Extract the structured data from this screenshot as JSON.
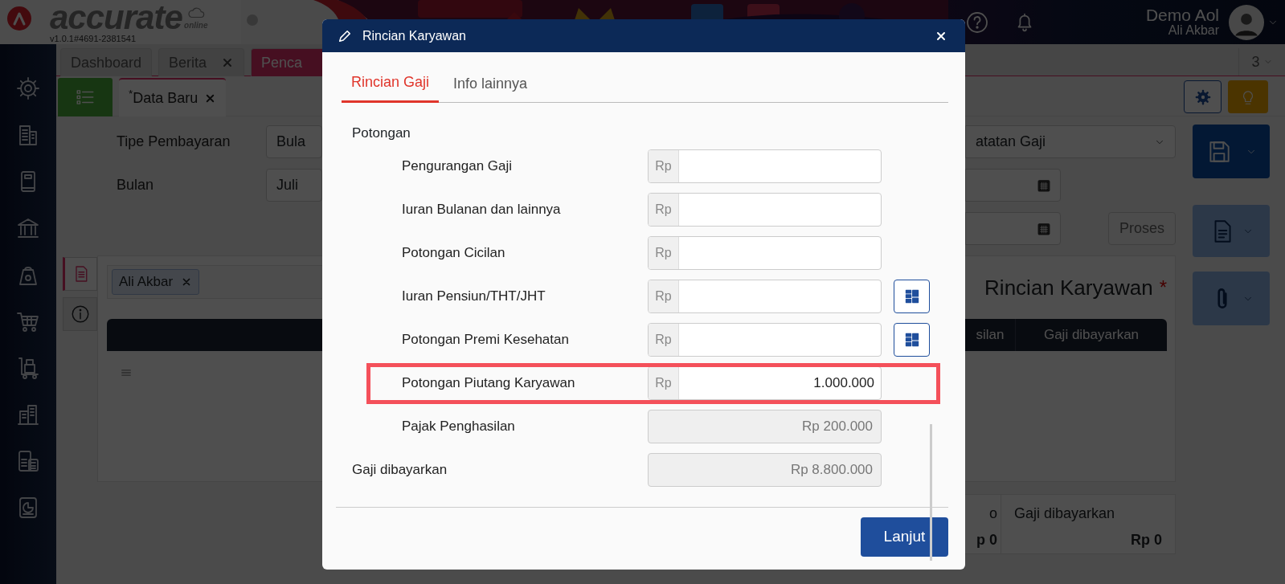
{
  "header": {
    "logo": "accurate",
    "logo_sub": "online",
    "version": "v1.0.1#4691-2381541",
    "user_name": "Demo Aol",
    "user_sub": "Ali Akbar"
  },
  "tabs": [
    {
      "label": "Dashboard",
      "selected": false,
      "closable": false
    },
    {
      "label": "Berita",
      "selected": false,
      "closable": true
    },
    {
      "label": "Penca",
      "selected": true,
      "closable": false
    }
  ],
  "tab_count": "3",
  "subtabs": [
    {
      "label": "$^{*}$Data Baru",
      "selected": true,
      "closable": true
    }
  ],
  "form": {
    "left": [
      {
        "label": "Tipe Pembayaran",
        "value": "Bula"
      },
      {
        "label": "Bulan",
        "value": "Juli"
      }
    ],
    "right": [
      {
        "kind": "select",
        "value": "atatan Gaji"
      },
      {
        "kind": "date"
      },
      {
        "kind": "date",
        "button": {
          "label": "Proses",
          "disabled": true
        }
      }
    ]
  },
  "side_tabs": [
    {
      "kind": "document",
      "selected": true
    },
    {
      "kind": "info",
      "selected": false
    }
  ],
  "panel": {
    "tags": [
      {
        "label": "Ali Akbar"
      }
    ],
    "title": "Rincian Karyawan",
    "required_mark": "*",
    "columns": [
      "silan",
      "Gaji dibayarkan"
    ]
  },
  "summary": [
    {
      "label": "o",
      "value": "p 0"
    },
    {
      "label": "Gaji dibayarkan",
      "value": "Rp 0"
    }
  ],
  "modal": {
    "title": "Rincian Karyawan",
    "tabs": [
      {
        "label": "Rincian Gaji",
        "selected": true
      },
      {
        "label": "Info lainnya",
        "selected": false
      }
    ],
    "section": {
      "title": "Potongan",
      "rows": [
        {
          "label": "Pengurangan Gaji",
          "kind": "input",
          "prefix": "Rp",
          "lookup": false,
          "highlighted": false
        },
        {
          "label": "Iuran Bulanan dan lainnya",
          "kind": "input",
          "prefix": "Rp",
          "lookup": false,
          "highlighted": false
        },
        {
          "label": "Potongan Cicilan",
          "kind": "input",
          "prefix": "Rp",
          "lookup": false,
          "highlighted": false
        },
        {
          "label": "Iuran Pensiun/THT/JHT",
          "kind": "input",
          "prefix": "Rp",
          "lookup": true,
          "highlighted": false
        },
        {
          "label": "Potongan Premi Kesehatan",
          "kind": "input",
          "prefix": "Rp",
          "lookup": true,
          "highlighted": false
        },
        {
          "label": "Potongan Piutang Karyawan",
          "kind": "input",
          "prefix": "Rp",
          "value": "1.000.000",
          "lookup": false,
          "highlighted": true
        },
        {
          "label": "Pajak Penghasilan",
          "kind": "readonly",
          "value": "Rp 200.000",
          "lookup": false,
          "highlighted": false
        }
      ]
    },
    "total": {
      "label": "Gaji dibayarkan",
      "value": "Rp 8.800.000"
    },
    "primary_button": "Lanjut"
  }
}
